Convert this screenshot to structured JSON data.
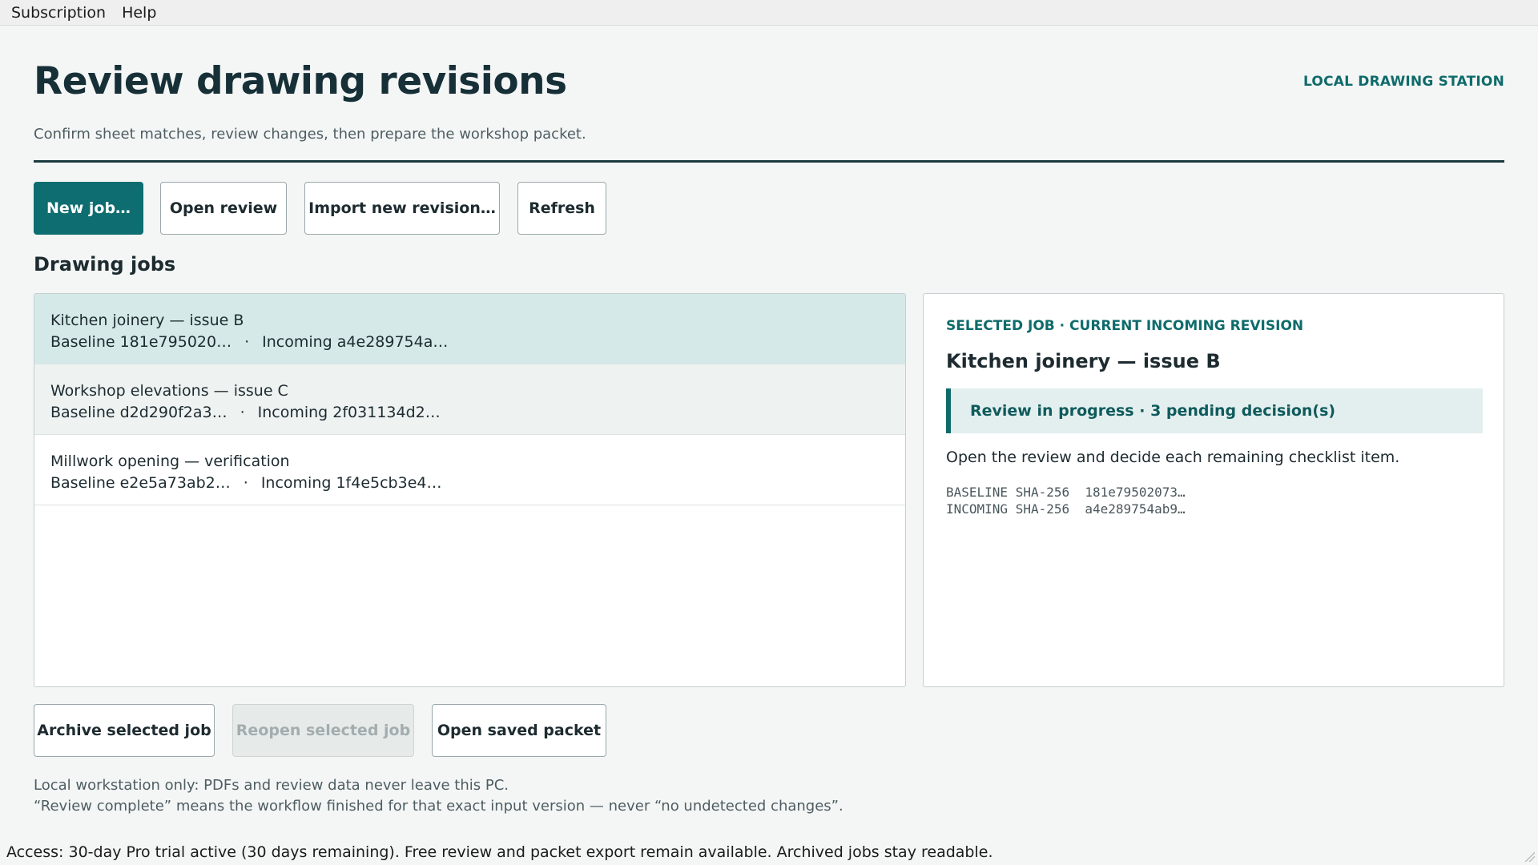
{
  "menubar": {
    "items": [
      {
        "label": "Subscription"
      },
      {
        "label": "Help"
      }
    ]
  },
  "header": {
    "title": "Review drawing revisions",
    "station": "LOCAL DRAWING STATION",
    "subtitle": "Confirm sheet matches, review changes, then prepare the workshop packet."
  },
  "toolbar": {
    "new_job": "New job…",
    "open_review": "Open review",
    "import_revision": "Import new revision…",
    "refresh": "Refresh"
  },
  "jobs": {
    "heading": "Drawing jobs",
    "separator": "·",
    "items": [
      {
        "name": "Kitchen joinery — issue B",
        "baseline": "Baseline 181e795020…",
        "incoming": "Incoming a4e289754a…",
        "selected": true
      },
      {
        "name": "Workshop elevations — issue C",
        "baseline": "Baseline d2d290f2a3…",
        "incoming": "Incoming 2f031134d2…",
        "selected": false
      },
      {
        "name": "Millwork opening — verification",
        "baseline": "Baseline e2e5a73ab2…",
        "incoming": "Incoming 1f4e5cb3e4…",
        "selected": false
      }
    ]
  },
  "detail": {
    "kicker": "SELECTED JOB · CURRENT INCOMING REVISION",
    "title": "Kitchen joinery — issue B",
    "status": "Review in progress · 3 pending decision(s)",
    "instructions": "Open the review and decide each remaining checklist item.",
    "baseline_hash": "BASELINE SHA-256  181e79502073…",
    "incoming_hash": "INCOMING SHA-256  a4e289754ab9…"
  },
  "actions": {
    "archive": "Archive selected job",
    "reopen": "Reopen selected job",
    "open_packet": "Open saved packet"
  },
  "footer": {
    "note1": "Local workstation only: PDFs and review data never leave this PC.",
    "note2": "“Review complete” means the workflow finished for that exact input version — never “no undetected changes”.",
    "access": "Access: 30-day Pro trial active (30 days remaining). Free review and packet export remain available. Archived jobs stay readable."
  },
  "colors": {
    "accent": "#0d6d70",
    "selected_row": "#d5e9e8",
    "status_bg": "#e3efee"
  }
}
